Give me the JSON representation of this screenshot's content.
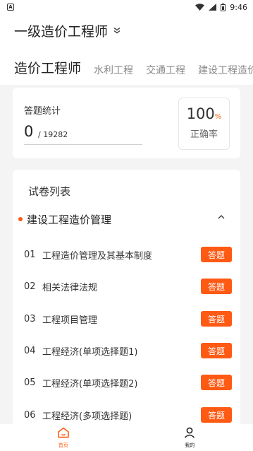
{
  "status_bar": {
    "time": "9:46",
    "left_icon": "A"
  },
  "header": {
    "title": "一级造价工程师",
    "tabs": [
      "造价工程师",
      "水利工程",
      "交通工程",
      "建设工程造价"
    ]
  },
  "stats": {
    "label": "答题统计",
    "answered": "0",
    "total": "/ 19282",
    "rate_value": "100",
    "rate_unit": "%",
    "rate_label": "正确率"
  },
  "paper_list": {
    "title": "试卷列表",
    "section": "建设工程造价管理",
    "items": [
      {
        "num": "01",
        "name": "工程造价管理及其基本制度",
        "action": "答题"
      },
      {
        "num": "02",
        "name": "相关法律法规",
        "action": "答题"
      },
      {
        "num": "03",
        "name": "工程项目管理",
        "action": "答题"
      },
      {
        "num": "04",
        "name": "工程经济(单项选择题1)",
        "action": "答题"
      },
      {
        "num": "05",
        "name": "工程经济(单项选择题2)",
        "action": "答题"
      },
      {
        "num": "06",
        "name": "工程经济(多项选择题)",
        "action": "答题"
      }
    ]
  },
  "bottom_nav": {
    "home": "首页",
    "mine": "我的"
  },
  "colors": {
    "accent": "#ff5a14",
    "background": "#f4f4f4"
  }
}
